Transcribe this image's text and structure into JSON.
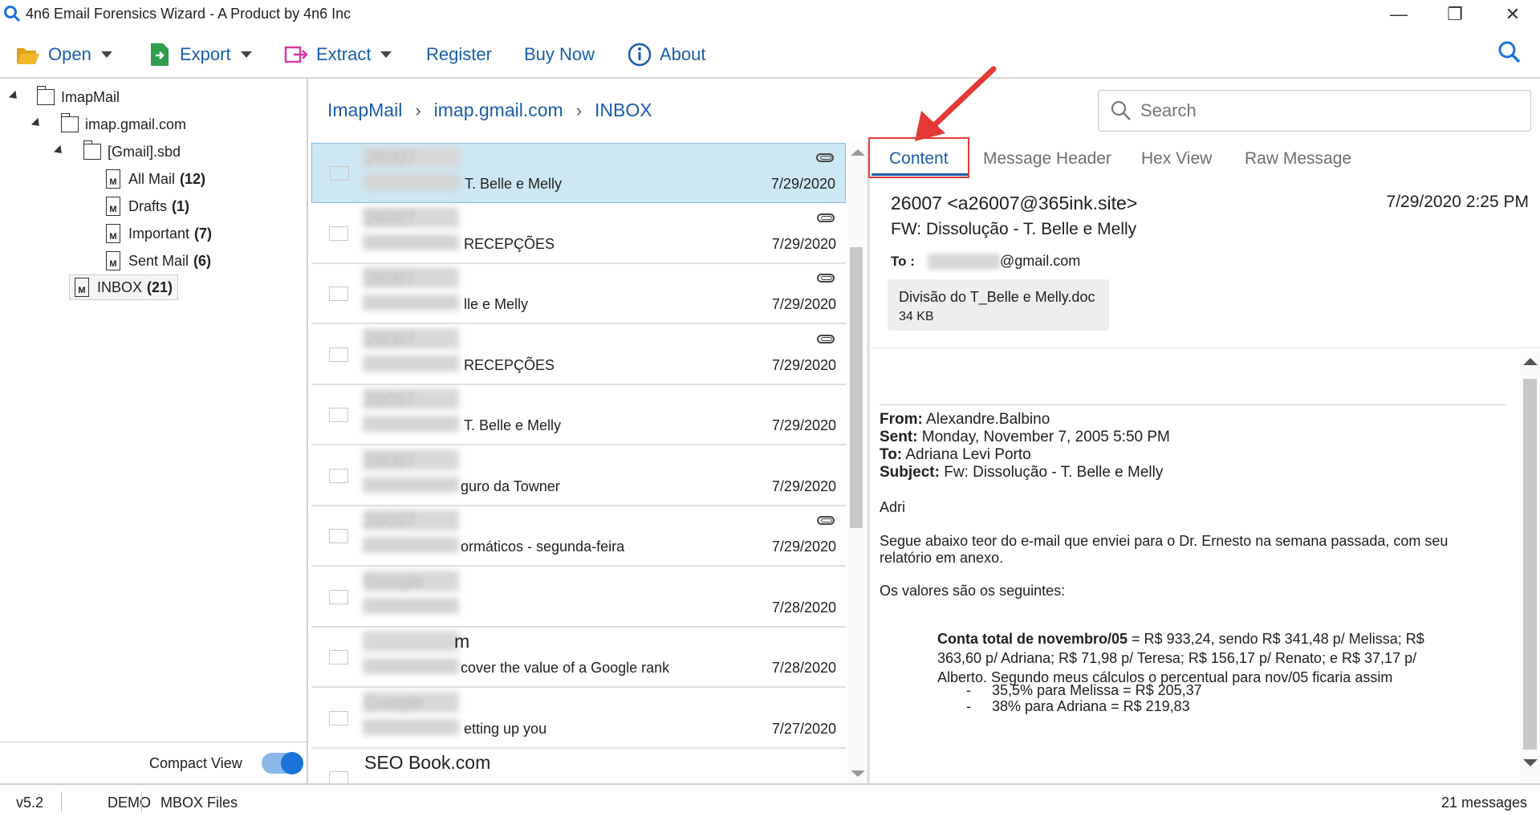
{
  "window": {
    "title": "4n6 Email Forensics Wizard - A Product by 4n6 Inc",
    "minimize": "—",
    "restore": "❐",
    "close": "✕"
  },
  "toolbar": {
    "open": "Open",
    "export": "Export",
    "extract": "Extract",
    "register": "Register",
    "buy_now": "Buy Now",
    "about": "About"
  },
  "tree": {
    "root": "ImapMail",
    "account": "imap.gmail.com",
    "gmail_folder": "[Gmail].sbd",
    "folders": [
      {
        "label": "All Mail",
        "count": "(12)"
      },
      {
        "label": "Drafts",
        "count": "(1)"
      },
      {
        "label": "Important",
        "count": "(7)"
      },
      {
        "label": "Sent Mail",
        "count": "(6)"
      }
    ],
    "inbox": {
      "label": "INBOX",
      "count": "(21)"
    }
  },
  "compact_view": {
    "label": "Compact View",
    "enabled": true
  },
  "breadcrumb": [
    "ImapMail",
    "imap.gmail.com",
    "INBOX"
  ],
  "search": {
    "placeholder": "Search"
  },
  "messages": [
    {
      "from": "26007",
      "subject": "T. Belle e Melly",
      "date": "7/29/2020",
      "attachment": true,
      "selected": true
    },
    {
      "from": "26007",
      "subject": "RECEPÇÕES",
      "date": "7/29/2020",
      "attachment": true
    },
    {
      "from": "26007",
      "subject": "lle e Melly",
      "date": "7/29/2020",
      "attachment": true
    },
    {
      "from": "26007",
      "subject": "RECEPÇÕES",
      "date": "7/29/2020",
      "attachment": true
    },
    {
      "from": "26007",
      "subject": "T. Belle e Melly",
      "date": "7/29/2020",
      "attachment": false
    },
    {
      "from": "26007",
      "subject": "guro da Towner",
      "date": "7/29/2020",
      "attachment": false
    },
    {
      "from": "26007",
      "subject": "ormáticos - segunda-feira",
      "date": "7/29/2020",
      "attachment": true
    },
    {
      "from": "Google",
      "subject": "",
      "date": "7/28/2020",
      "attachment": false
    },
    {
      "from": "m",
      "subject": "cover the value of a Google rank",
      "date": "7/28/2020",
      "attachment": false
    },
    {
      "from": "Google",
      "subject": "etting up you",
      "date": "7/27/2020",
      "attachment": false
    },
    {
      "from": "SEO Book.com",
      "subject": "",
      "date": "",
      "attachment": false
    }
  ],
  "tabs": {
    "content": "Content",
    "header": "Message Header",
    "hex": "Hex View",
    "raw": "Raw Message"
  },
  "preview": {
    "from": "26007 <a26007@365ink.site>",
    "date": "7/29/2020 2:25 PM",
    "subject": "FW: Dissolução - T. Belle e Melly",
    "to_label": "To :",
    "to_domain": "@gmail.com",
    "attachment": {
      "name": "Divisão do T_Belle e Melly.doc",
      "size": "34 KB"
    }
  },
  "body": {
    "from_label": "From:",
    "from_value": " Alexandre.Balbino",
    "sent_label": "Sent:",
    "sent_value": " Monday, November 7, 2005 5:50 PM",
    "to_label": "To:",
    "to_value": " Adriana Levi Porto",
    "subject_label": "Subject:",
    "subject_value": " Fw: Dissolução - T. Belle e Melly",
    "greeting": "Adri",
    "para1": "Segue abaixo teor do e-mail que enviei para o Dr. Ernesto na semana passada, com seu relatório em anexo.",
    "para2": "Os valores são os seguintes:",
    "total_label": "Conta total de novembro/05",
    "total_text": " = R$ 933,24, sendo R$ 341,48 p/ Melissa; R$ 363,60 p/ Adriana; R$ 71,98 p/ Teresa; R$ 156,17 p/ Renato; e R$ 37,17 p/ Alberto. Segundo meus cálculos o percentual para nov/05 ficaria assim",
    "bullet_marker": "-",
    "bullet1": "35,5% para Melissa = R$ 205,37",
    "bullet2": "38% para Adriana = R$ 219,83"
  },
  "status": {
    "version": "v5.2",
    "mode": "DEMO",
    "type": "MBOX Files",
    "count": "21 messages"
  },
  "colors": {
    "accent": "#1a5dab",
    "highlight": "#e53935",
    "selected_row": "#cce8f4"
  }
}
